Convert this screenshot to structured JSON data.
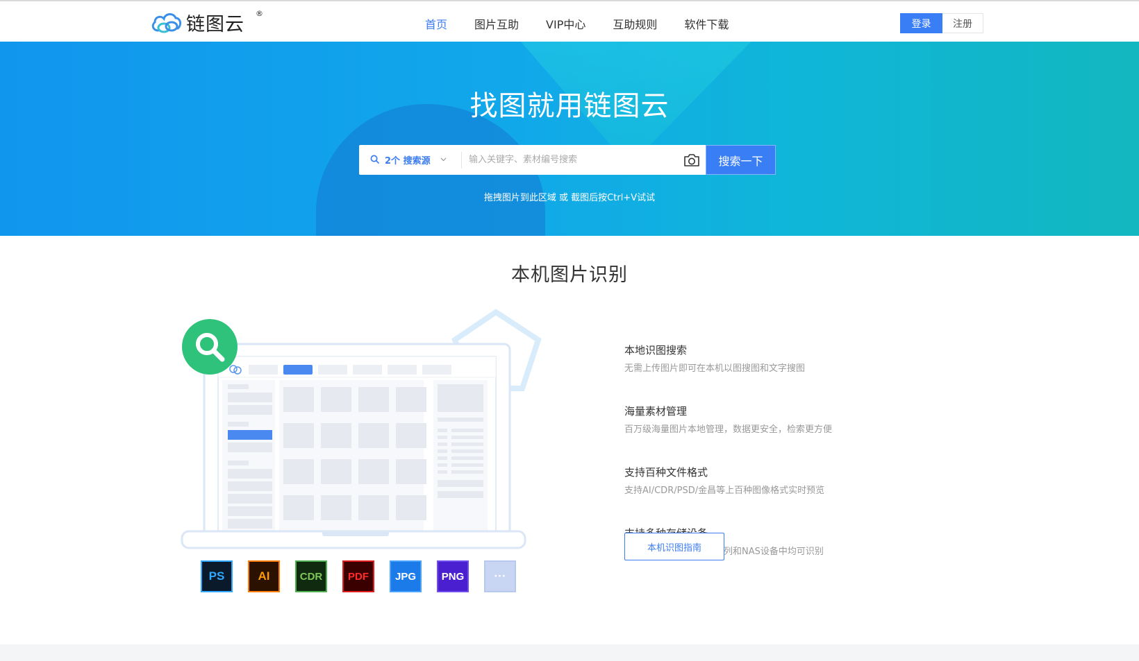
{
  "header": {
    "logo_text": "链图云",
    "logo_reg": "®",
    "nav": [
      {
        "label": "首页",
        "active": true
      },
      {
        "label": "图片互助",
        "active": false
      },
      {
        "label": "VIP中心",
        "active": false
      },
      {
        "label": "互助规则",
        "active": false
      },
      {
        "label": "软件下载",
        "active": false
      }
    ],
    "login_label": "登录",
    "register_label": "注册"
  },
  "hero": {
    "title": "找图就用链图云",
    "search_source_label": "2个 搜索源",
    "search_placeholder": "输入关键字、素材编号搜索",
    "search_button": "搜索一下",
    "hint": "拖拽图片到此区域 或 截图后按Ctrl+V试试"
  },
  "section": {
    "title": "本机图片识别",
    "features": [
      {
        "title": "本地识图搜索",
        "desc": "无需上传图片即可在本机以图搜图和文字搜图"
      },
      {
        "title": "海量素材管理",
        "desc": "百万级海量图片本地管理，数据更安全，检索更方便"
      },
      {
        "title": "支持百种文件格式",
        "desc": "支持AI/CDR/PSD/金昌等上百种图像格式实时预览"
      },
      {
        "title": "支持多种存储设备",
        "desc": "图片在移动硬盘、磁盘阵列和NAS设备中均可识别"
      }
    ],
    "guide_button": "本机识图指南",
    "formats": [
      {
        "label": "PS",
        "bg": "#0b1a2b",
        "fg": "#31a8ff",
        "border": "#31a8ff"
      },
      {
        "label": "AI",
        "bg": "#2b1200",
        "fg": "#ff9a00",
        "border": "#ff7c00"
      },
      {
        "label": "CDR",
        "bg": "#0f2a0f",
        "fg": "#7fc75a",
        "border": "#4caf50"
      },
      {
        "label": "PDF",
        "bg": "#3a0000",
        "fg": "#ff2b2b",
        "border": "#e21b1b"
      },
      {
        "label": "JPG",
        "bg": "#1b7be8",
        "fg": "#ffffff",
        "border": "#4aa2ff"
      },
      {
        "label": "PNG",
        "bg": "#4a1fd0",
        "fg": "#ffffff",
        "border": "#6e4cf0"
      },
      {
        "label": "···",
        "bg": "#c9d6f3",
        "fg": "#ffffff",
        "border": "#b7c8ef"
      }
    ]
  },
  "colors": {
    "accent": "#3a7ef5",
    "search_green": "#2fc27b"
  }
}
